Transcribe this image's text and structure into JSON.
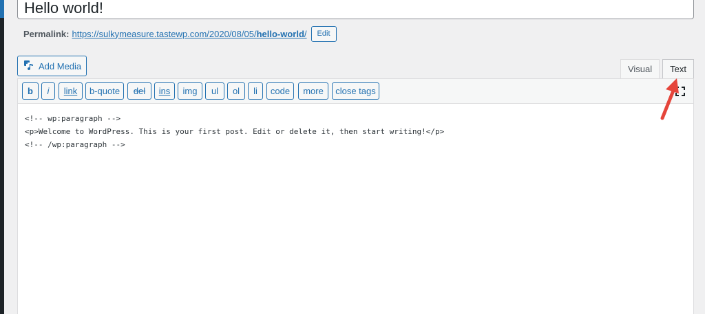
{
  "post": {
    "title": "Hello world!"
  },
  "permalink": {
    "label": "Permalink:",
    "url_prefix": "https://sulkymeasure.tastewp.com/2020/08/05/",
    "slug": "hello-world",
    "url_suffix": "/",
    "edit_label": "Edit"
  },
  "media": {
    "add_label": "Add Media"
  },
  "tabs": [
    {
      "label": "Visual",
      "active": false
    },
    {
      "label": "Text",
      "active": true
    }
  ],
  "toolbar": {
    "buttons": [
      "b",
      "i",
      "link",
      "b-quote",
      "del",
      "ins",
      "img",
      "ul",
      "ol",
      "li",
      "code",
      "more",
      "close tags"
    ]
  },
  "content": {
    "lines": [
      "<!-- wp:paragraph -->",
      "<p>Welcome to WordPress. This is your first post. Edit or delete it, then start writing!</p>",
      "<!-- /wp:paragraph -->"
    ]
  },
  "colors": {
    "accent": "#2271b1",
    "annotation_arrow": "#e5453b",
    "background": "#f0f0f1"
  }
}
